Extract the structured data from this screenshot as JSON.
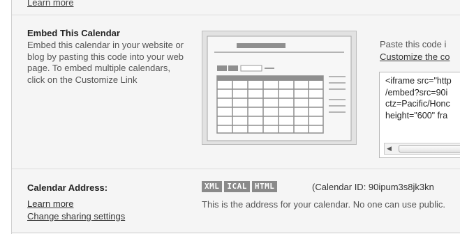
{
  "top": {
    "learn_more": "Learn more"
  },
  "embed": {
    "title": "Embed This Calendar",
    "description": "Embed this calendar in your website or blog by pasting this code into your web page. To embed multiple calendars, click on the Customize Link",
    "paste_text": "Paste this code i",
    "customize_link": "Customize the co",
    "code_lines": [
      "<iframe src=\"http",
      "/embed?src=90i",
      "ctz=Pacific/Honc",
      "height=\"600\" fra"
    ]
  },
  "address": {
    "title": "Calendar Address:",
    "learn_more": "Learn more",
    "change_sharing": "Change sharing settings",
    "badges": [
      "XML",
      "ICAL",
      "HTML"
    ],
    "calendar_id": "(Calendar ID: 90ipum3s8jk3kn",
    "description": "This is the address for your calendar. No one can use public."
  },
  "colors": {
    "panel_bg": "#f5f5f5",
    "badge_bg": "#8a8a8a",
    "text": "#555555"
  }
}
